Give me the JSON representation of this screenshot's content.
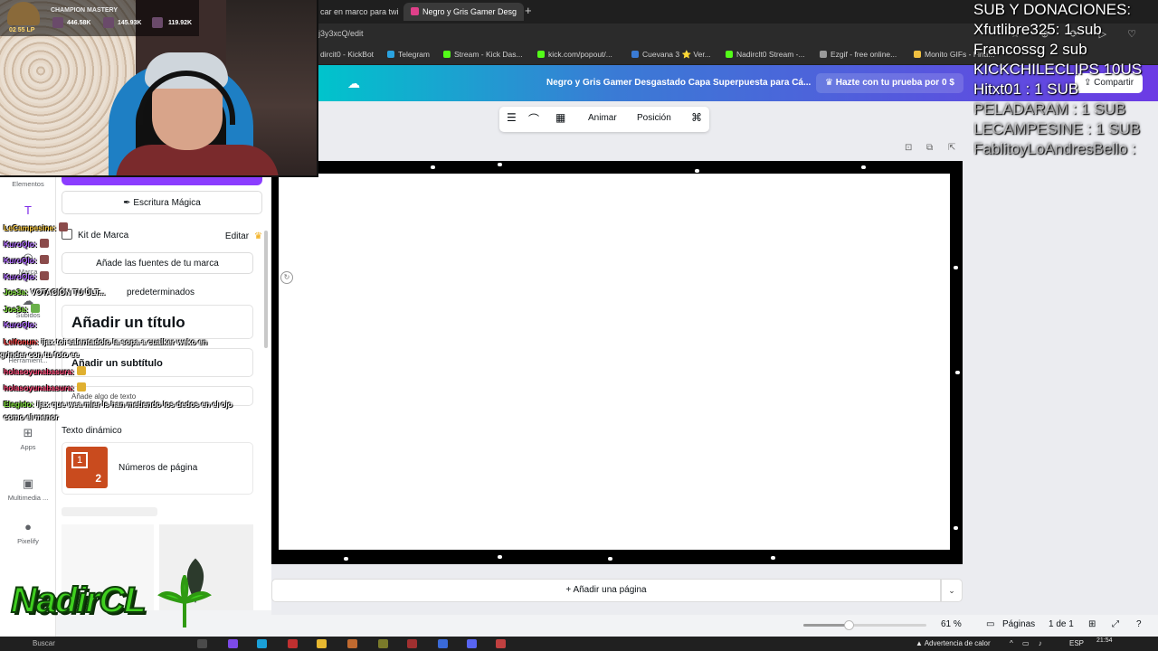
{
  "browser": {
    "tabs": [
      {
        "label": "car en marco para twi",
        "active": false
      },
      {
        "label": "Negro y Gris Gamer Desg",
        "active": true
      }
    ],
    "url": "j3y3xcQ/edit",
    "bookmarks": [
      {
        "label": "dircit0 - KickBot",
        "color": "#3a3a3a"
      },
      {
        "label": "Telegram",
        "color": "#2aa3e0"
      },
      {
        "label": "Stream - Kick Das...",
        "color": "#53fc18"
      },
      {
        "label": "kick.com/popout/...",
        "color": "#53fc18"
      },
      {
        "label": "Cuevana 3 ⭐ Ver...",
        "color": "#3a7bd5"
      },
      {
        "label": "Nadirclt0 Stream -...",
        "color": "#53fc18"
      },
      {
        "label": "Ezgif - free online...",
        "color": "#9a9a9a"
      },
      {
        "label": "Monito GIFs - Fina...",
        "color": "#f0c040"
      }
    ]
  },
  "canva": {
    "doc_title": "Negro y Gris Gamer Desgastado Capa Superpuesta para Cá...",
    "trial_label": "Hazte con tu prueba por 0 $",
    "share_label": "Compartir",
    "rail": [
      {
        "label": "Elementos",
        "icon": "shapes-icon"
      },
      {
        "label": "",
        "icon": "text-icon"
      },
      {
        "label": "Marca",
        "icon": "brand-icon"
      },
      {
        "label": "Subidos",
        "icon": "upload-icon"
      },
      {
        "label": "Herramient...",
        "icon": "tools-icon"
      },
      {
        "label": "Apps",
        "icon": "apps-icon"
      },
      {
        "label": "Multimedia ...",
        "icon": "media-icon"
      },
      {
        "label": "Pixelify",
        "icon": "pixelify-icon"
      }
    ],
    "panel": {
      "magic_label": "Escritura Mágica",
      "kit_label": "Kit de Marca",
      "kit_edit": "Editar",
      "fonts_btn": "Añade las fuentes de tu marca",
      "defaults_label": "predeterminados",
      "title_text": "Añadir un título",
      "subtitle_text": "Añadir un subtítulo",
      "body_text": "Añade algo de texto",
      "dynamic_label": "Texto dinámico",
      "page_numbers": "Números de página"
    },
    "toolbar": {
      "animate": "Animar",
      "position": "Posición"
    },
    "add_page": "+ Añadir una página",
    "footer": {
      "zoom_value": 0.61,
      "zoom_label": "61 %",
      "pages_label": "Páginas",
      "page_count": "1 de 1"
    }
  },
  "chat": [
    {
      "user": "LeCampesine:",
      "color": "#ffd04a",
      "text": "",
      "emote": true
    },
    {
      "user": "KuroQlo:",
      "color": "#b06bff",
      "text": "",
      "emote": true
    },
    {
      "user": "KuroQlo:",
      "color": "#b06bff",
      "text": "",
      "emote": true
    },
    {
      "user": "KuroQlo:",
      "color": "#b06bff",
      "text": "",
      "emote": true
    },
    {
      "user": "Jos3a:",
      "color": "#7fe03a",
      "text": "VOTACIÓN TU ÚLT...",
      "emote": false
    },
    {
      "user": "Jos3a:",
      "color": "#7fe03a",
      "text": "",
      "emote": true
    },
    {
      "user": "KuroQlo:",
      "color": "#b06bff",
      "text": "",
      "emote": false
    },
    {
      "user": "Lelfonun:",
      "color": "#ff4a4a",
      "text": "ijax toi salentadolo la sopa a cualker weko en",
      "emote": false
    },
    {
      "user": "",
      "color": "#ffffff",
      "text": "grinder con tu foto ee",
      "emote": false
    },
    {
      "user": "holasoyunabasura:",
      "color": "#ff4a7a",
      "text": "",
      "emote": true
    },
    {
      "user": "holasoyunabasura:",
      "color": "#ff4a7a",
      "text": "",
      "emote": true
    },
    {
      "user": "Elegido:",
      "color": "#7fe03a",
      "text": "ijax que wea mier ls han metiendo los dedos en el ojo",
      "emote": false
    },
    {
      "user": "",
      "color": "#ffffff",
      "text": "como el menor",
      "emote": false
    }
  ],
  "webcam": {
    "mastery_title": "CHAMPION MASTERY",
    "lp_label": "02 55 LP",
    "stats": [
      "446.58K",
      "145.93K",
      "119.92K"
    ]
  },
  "subs_overlay": {
    "lines": [
      {
        "text": "SUB Y DONACIONES:",
        "faded": false
      },
      {
        "text": "Xfutlibre325: 1 sub",
        "faded": false
      },
      {
        "text": "Francossg 2 sub",
        "faded": false
      },
      {
        "text": "KICKCHILECLIPS 10US",
        "faded": false
      },
      {
        "text": "Hitxt01 : 1 SUB",
        "faded": false
      },
      {
        "text": "PELADARAM : 1 SUB",
        "faded": true
      },
      {
        "text": "LECAMPESINE : 1 SUB",
        "faded": true
      },
      {
        "text": "FablitoyLoAndresBello :",
        "faded": true
      }
    ]
  },
  "streamer_logo": "NadirCL",
  "taskbar": {
    "search": "Buscar",
    "warning": "Advertencia de calor",
    "lang": "ESP",
    "time": "21:54"
  }
}
